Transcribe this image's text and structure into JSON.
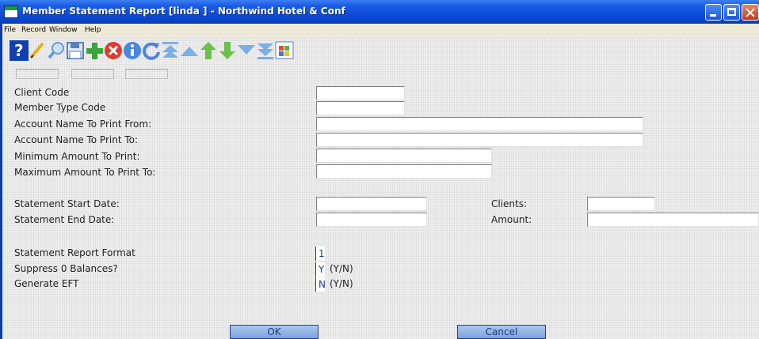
{
  "window": {
    "title": "Member Statement Report [linda   ] - Northwind Hotel & Conf"
  },
  "menu": {
    "items": [
      "File",
      "Record",
      "Window",
      "Help"
    ]
  },
  "toolbar": {
    "icons": [
      "help-icon",
      "edit-pencil-icon",
      "search-magnifier-icon",
      "save-disk-icon",
      "add-plus-icon",
      "delete-x-icon",
      "info-icon",
      "refresh-icon",
      "first-record-icon",
      "previous-record-icon",
      "up-arrow-icon",
      "down-arrow-icon",
      "next-record-icon",
      "last-record-icon",
      "windows-logo-icon"
    ]
  },
  "form": {
    "client_code": {
      "label": "Client Code",
      "value": ""
    },
    "member_type_code": {
      "label": "Member Type Code",
      "value": ""
    },
    "account_name_from": {
      "label": "Account Name To Print From:",
      "value": ""
    },
    "account_name_to": {
      "label": "Account Name To Print To:",
      "value": ""
    },
    "min_amount": {
      "label": "Minimum Amount To Print:",
      "value": ""
    },
    "max_amount": {
      "label": "Maximum Amount To Print To:",
      "value": ""
    },
    "statement_start_date": {
      "label": "Statement Start Date:",
      "value": ""
    },
    "statement_end_date": {
      "label": "Statement End Date:",
      "value": ""
    },
    "clients": {
      "label": "Clients:",
      "value": ""
    },
    "amount": {
      "label": "Amount:",
      "value": ""
    },
    "report_format": {
      "label": "Statement Report Format",
      "value": "1"
    },
    "suppress_zero": {
      "label": "Suppress 0 Balances?",
      "value": "Y",
      "hint": "(Y/N)"
    },
    "generate_eft": {
      "label": "Generate EFT",
      "value": "N",
      "hint": "(Y/N)"
    }
  },
  "buttons": {
    "ok": "OK",
    "cancel": "Cancel"
  },
  "colors": {
    "title_bar": "#0a48d4",
    "window_frame": "#0a3fa8",
    "button_face": "#8fb3e6"
  }
}
